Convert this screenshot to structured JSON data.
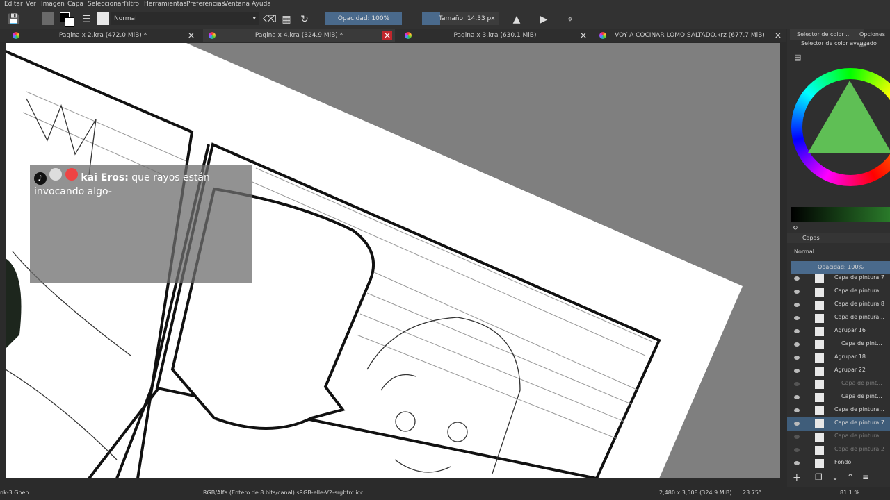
{
  "menu": [
    "Editar",
    "Ver",
    "Imagen",
    "Capa",
    "Seleccionar",
    "Filtro",
    "Herramientas",
    "Preferencias",
    "Ventana",
    "Ayuda"
  ],
  "toolbar": {
    "blend_mode": "Normal",
    "opacity_label": "Opacidad: 100%",
    "size_label": "Tamaño: 14.33 px"
  },
  "tabs": [
    {
      "title": "Pagina x 2.kra (472.0 MiB) *"
    },
    {
      "title": "Pagina x 4.kra (324.9 MiB) *"
    },
    {
      "title": "Pagina x 3.kra (630.1 MiB)"
    },
    {
      "title": "VOY A COCINAR LOMO SALTADO.krz (677.7 MiB)"
    }
  ],
  "dock": {
    "tab_color_selector": "Selector de color ...",
    "tab_options": "Opciones de",
    "color_selector_title": "Selector de color avanzado",
    "layers_title": "Capas",
    "layers_blend": "Normal",
    "layers_opacity": "Opacidad:  100%",
    "layers": [
      {
        "name": "Capa de pintura 7",
        "dim": false
      },
      {
        "name": "Capa de pintura...",
        "dim": false
      },
      {
        "name": "Capa de pintura 8",
        "dim": false
      },
      {
        "name": "Capa de pintura...",
        "dim": false
      },
      {
        "name": "Agrupar 16",
        "dim": false
      },
      {
        "name": "Capa de pint...",
        "dim": false
      },
      {
        "name": "Agrupar 18",
        "dim": false
      },
      {
        "name": "Agrupar 22",
        "dim": false
      },
      {
        "name": "Capa de pint...",
        "dim": true
      },
      {
        "name": "Capa de pint...",
        "dim": false
      },
      {
        "name": "Capa de pintura...",
        "dim": false
      },
      {
        "name": "Capa de pintura 7",
        "dim": false,
        "selected": true
      },
      {
        "name": "Capa de pintura...",
        "dim": true
      },
      {
        "name": "Capa de pintura 2",
        "dim": true
      },
      {
        "name": "Fondo",
        "dim": false
      }
    ]
  },
  "chat": {
    "user": "kai Eros:",
    "message": "que rayos están invocando algo-"
  },
  "status": {
    "brush": "nk-3 Gpen",
    "color_info": "RGB/Alfa (Entero de 8 bits/canal)  sRGB-elle-V2-srgbtrc.icc",
    "dimensions": "2,480 x 3,508 (324.9 MiB)",
    "rotation": "23.75°",
    "zoom": "81.1 %"
  },
  "colors": {
    "accent": "#4a6a8c",
    "close_red": "#c0272d"
  }
}
